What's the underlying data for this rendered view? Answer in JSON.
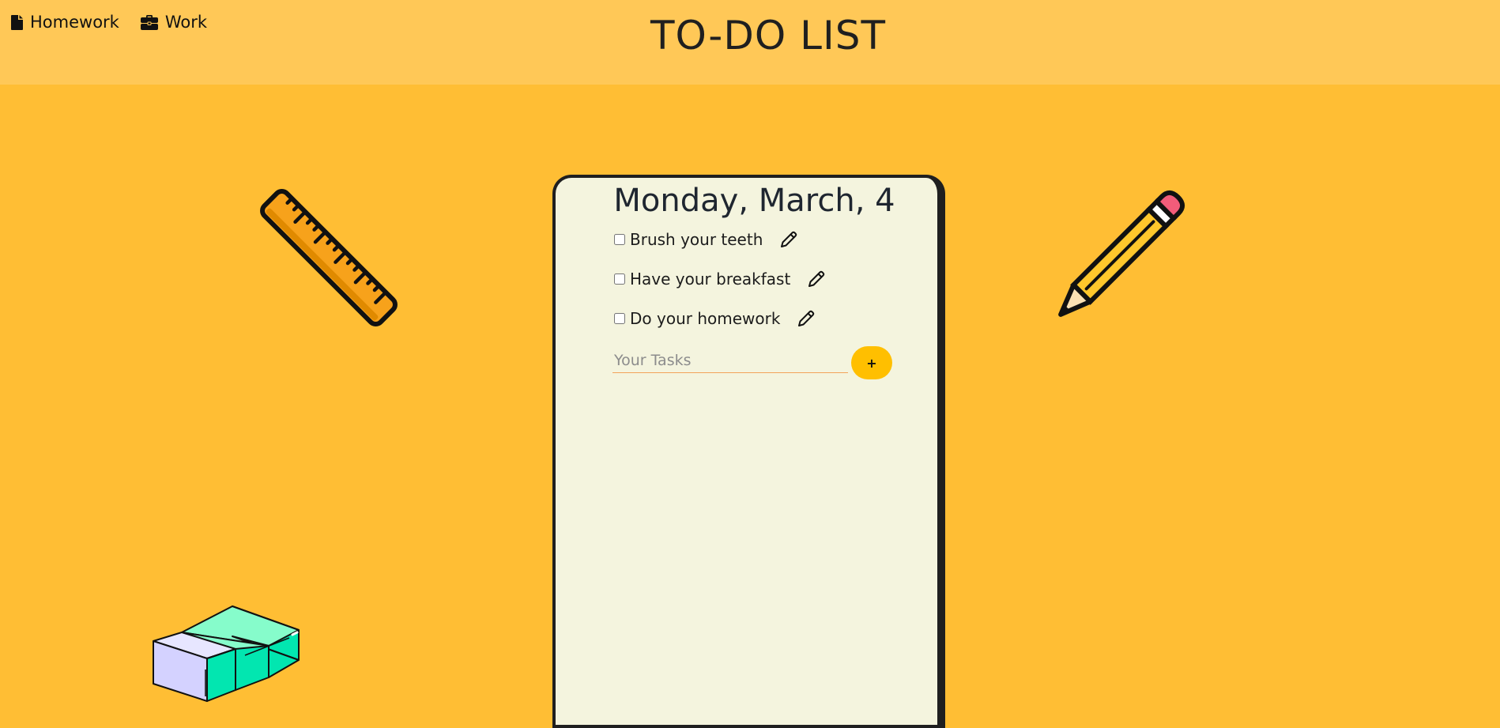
{
  "header": {
    "title": "TO-DO LIST",
    "nav": [
      {
        "label": "Homework",
        "icon": "file-icon"
      },
      {
        "label": "Work",
        "icon": "briefcase-icon"
      }
    ]
  },
  "card": {
    "date": "Monday, March, 4",
    "tasks": [
      {
        "label": "Brush your teeth",
        "checked": false
      },
      {
        "label": "Have your breakfast",
        "checked": false
      },
      {
        "label": "Do your homework",
        "checked": false
      }
    ],
    "input_placeholder": "Your Tasks",
    "add_label": "+"
  },
  "decorations": [
    "ruler-icon",
    "pencil-icon",
    "eraser-icon"
  ],
  "colors": {
    "background": "#FFBE34",
    "header": "#FFC857",
    "card": "#F4F4DE",
    "add_button": "#FFBF00"
  }
}
